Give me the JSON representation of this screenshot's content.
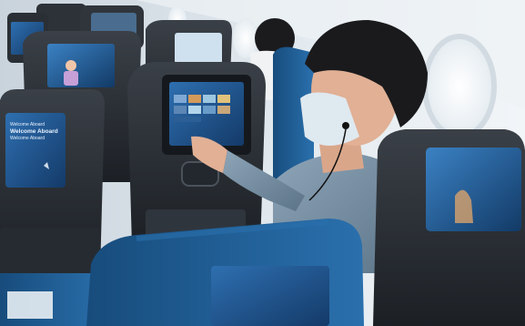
{
  "photo": {
    "subject": "passenger-using-seatback-screen",
    "colors": {
      "cabin_wall": "#dfe6ec",
      "seat_shell": "#2b3036",
      "seat_fabric": "#1f5f96",
      "screen_blue": "#1b4f88",
      "screen_glow": "#3f8fd6",
      "shirt": "#6f8aa0",
      "hair": "#1a1a1c",
      "skin": "#e1b095",
      "mask": "#dfe9f0",
      "window_light": "#f4f8fb"
    }
  },
  "left_screen": {
    "line1": "Welcome Aboard",
    "line2": "Welcome Aboard",
    "line3": "Welcome Aboard"
  }
}
